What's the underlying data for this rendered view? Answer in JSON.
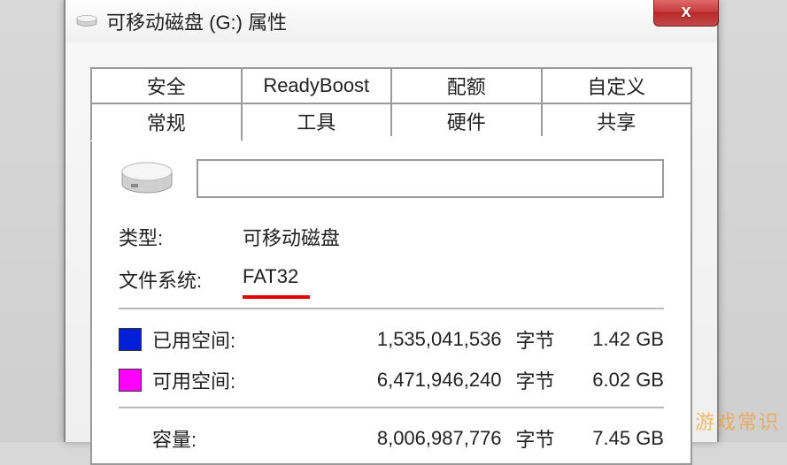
{
  "window": {
    "title": "可移动磁盘 (G:) 属性",
    "close_label": "x"
  },
  "tabs": {
    "row1": [
      "安全",
      "ReadyBoost",
      "配额",
      "自定义"
    ],
    "row2": [
      "常规",
      "工具",
      "硬件",
      "共享"
    ],
    "active": "常规"
  },
  "general": {
    "name_value": "",
    "type_label": "类型:",
    "type_value": "可移动磁盘",
    "filesystem_label": "文件系统:",
    "filesystem_value": "FAT32",
    "used_label": "已用空间:",
    "used_bytes": "1,535,041,536",
    "used_gb": "1.42 GB",
    "free_label": "可用空间:",
    "free_bytes": "6,471,946,240",
    "free_gb": "6.02 GB",
    "capacity_label": "容量:",
    "capacity_bytes": "8,006,987,776",
    "capacity_gb": "7.45 GB",
    "bytes_unit": "字节",
    "colors": {
      "used": "#0020d8",
      "free": "#ff00ff"
    }
  },
  "watermark": "游戏常识"
}
